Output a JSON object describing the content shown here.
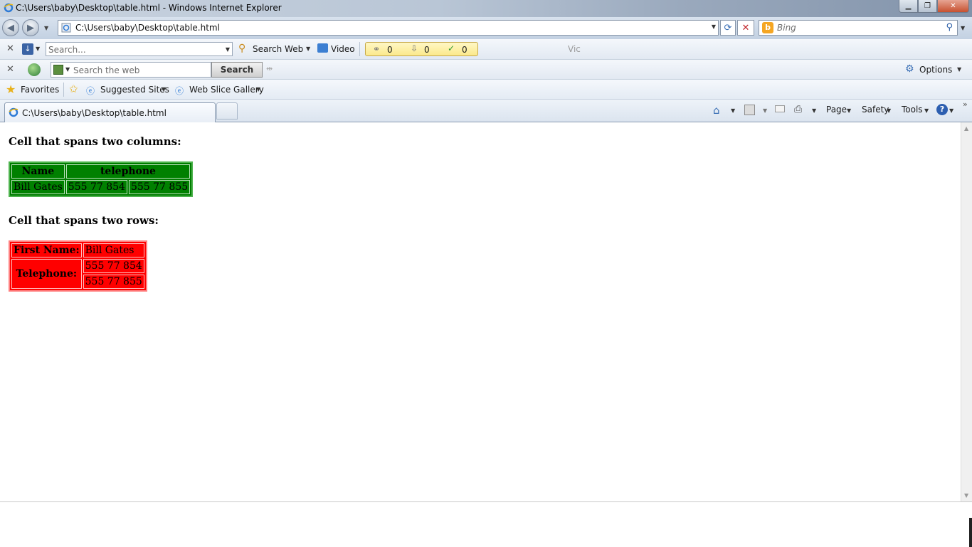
{
  "window": {
    "title": "C:\\Users\\baby\\Desktop\\table.html - Windows Internet Explorer",
    "min_glyph": "▁",
    "max_glyph": "❐",
    "close_glyph": "✕"
  },
  "address_bar": {
    "url": "C:\\Users\\baby\\Desktop\\table.html",
    "search_placeholder": "Bing"
  },
  "toolbar1": {
    "search_placeholder": "Search...",
    "search_web_label": "Search Web",
    "video_label": "Video",
    "counters": [
      "0",
      "0",
      "0"
    ],
    "vic_label": "Vic"
  },
  "toolbar2": {
    "search_placeholder": "Search the web",
    "search_button": "Search",
    "options_label": "Options"
  },
  "favorites_bar": {
    "favorites_label": "Favorites",
    "suggested_sites": "Suggested Sites",
    "web_slice_gallery": "Web Slice Gallery"
  },
  "tabs": {
    "active_tab": "C:\\Users\\baby\\Desktop\\table.html"
  },
  "command_bar": {
    "page": "Page",
    "safety": "Safety",
    "tools": "Tools",
    "help_glyph": "?"
  },
  "content": {
    "heading1": "Cell that spans two columns:",
    "table1": {
      "headers": [
        "Name",
        "telephone"
      ],
      "row": [
        "Bill Gates",
        "555 77 854",
        "555 77 855"
      ]
    },
    "heading2": "Cell that spans two rows:",
    "table2": {
      "first_name_label": "First Name:",
      "first_name_value": "Bill Gates",
      "telephone_label": "Telephone:",
      "phones": [
        "555 77 854",
        "555 77 855"
      ]
    }
  },
  "colors": {
    "table1_bg": "#008000",
    "table2_bg": "#ff0000"
  }
}
